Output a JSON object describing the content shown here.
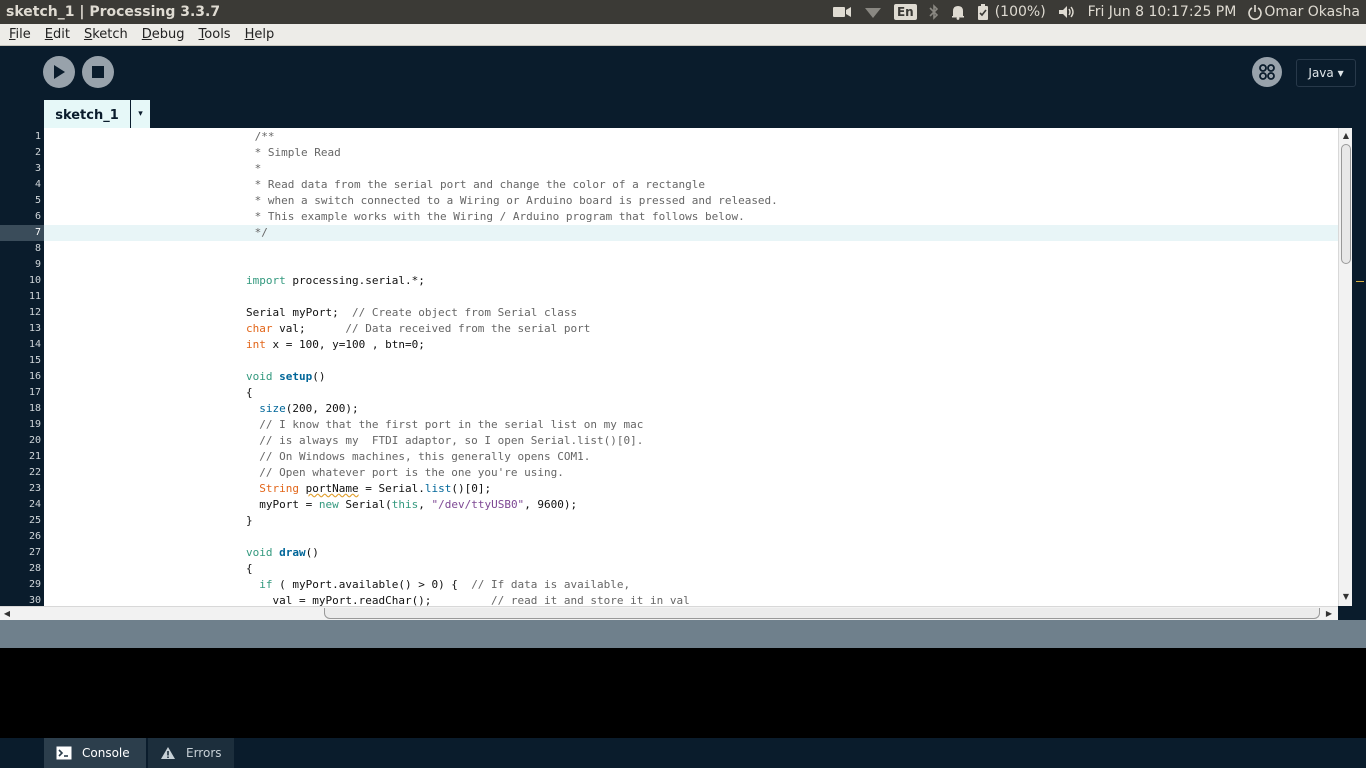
{
  "window": {
    "title": "sketch_1 | Processing 3.3.7"
  },
  "system": {
    "lang": "En",
    "battery": "(100%)",
    "clock": "Fri Jun  8 10:17:25 PM",
    "user": "Omar Okasha"
  },
  "menu": [
    {
      "acc": "F",
      "rest": "ile"
    },
    {
      "acc": "E",
      "rest": "dit"
    },
    {
      "acc": "S",
      "rest": "ketch"
    },
    {
      "acc": "D",
      "rest": "ebug"
    },
    {
      "acc": "T",
      "rest": "ools"
    },
    {
      "acc": "H",
      "rest": "elp"
    }
  ],
  "toolbar": {
    "mode": "Java ▾"
  },
  "tabs": {
    "active": "sketch_1",
    "menu_arrow": "▾"
  },
  "editor": {
    "line_numbers": [
      "1",
      "2",
      "3",
      "4",
      "5",
      "6",
      "7",
      "8",
      "9",
      "10",
      "11",
      "12",
      "13",
      "14",
      "15",
      "16",
      "17",
      "18",
      "19",
      "20",
      "21",
      "22",
      "23",
      "24",
      "25",
      "26",
      "27",
      "28",
      "29",
      "30"
    ],
    "current_line": 7,
    "code": {
      "l1": " /**",
      "l2": " * Simple Read",
      "l3": " *",
      "l4": " * Read data from the serial port and change the color of a rectangle",
      "l5": " * when a switch connected to a Wiring or Arduino board is pressed and released.",
      "l6": " * This example works with the Wiring / Arduino program that follows below.",
      "l7": " */",
      "l10_kw": "import",
      "l10_rest": " processing.serial.*;",
      "l12_a": "Serial myPort;  ",
      "l12_c": "// Create object from Serial class",
      "l13_t": "char",
      "l13_a": " val;      ",
      "l13_c": "// Data received from the serial port",
      "l14_t": "int",
      "l14_a": " x = 100, y=100 , btn=0;",
      "l16_kw": "void",
      "l16_fn": "setup",
      "l16_rest": "()",
      "l17": "{",
      "l18_fn": "size",
      "l18_rest": "(200, 200);",
      "l19": "  // I know that the first port in the serial list on my mac",
      "l20": "  // is always my  FTDI adaptor, so I open Serial.list()[0].",
      "l21": "  // On Windows machines, this generally opens COM1.",
      "l22": "  // Open whatever port is the one you're using.",
      "l23_t": "String",
      "l23_v": "portName",
      "l23_a": " = Serial.",
      "l23_fn": "list",
      "l23_rest": "()[0];",
      "l24_a": "  myPort = ",
      "l24_kw": "new",
      "l24_b": " Serial(",
      "l24_kw2": "this",
      "l24_c": ", ",
      "l24_s": "\"/dev/ttyUSB0\"",
      "l24_d": ", 9600);",
      "l25": "}",
      "l27_kw": "void",
      "l27_fn": "draw",
      "l27_rest": "()",
      "l28": "{",
      "l29_kw": "if",
      "l29_a": " ( myPort.available() > 0) {  ",
      "l29_c": "// If data is available,",
      "l30_a": "    val = myPort.readChar();         ",
      "l30_c": "// read it and store it in val"
    }
  },
  "footer": {
    "console": "Console",
    "errors": "Errors"
  }
}
